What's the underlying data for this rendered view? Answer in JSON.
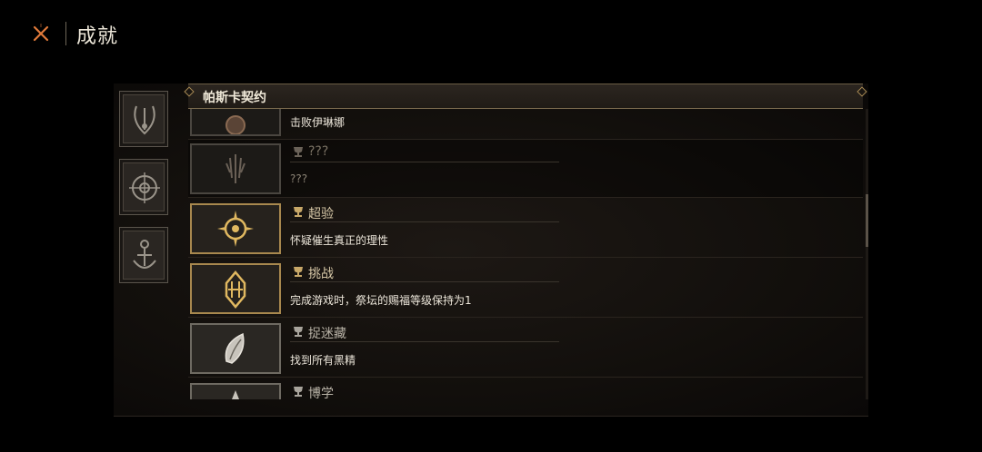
{
  "header": {
    "title": "成就"
  },
  "category": {
    "title": "帕斯卡契约"
  },
  "achievements": [
    {
      "name": "",
      "desc": "击败伊琳娜",
      "icon": "priest-head-icon"
    },
    {
      "name": "???",
      "desc": "???",
      "icon": "claw-sigil-icon"
    },
    {
      "name": "超验",
      "desc": "怀疑催生真正的理性",
      "icon": "crosshair-sun-icon"
    },
    {
      "name": "挑战",
      "desc": "完成游戏时，祭坛的赐福等级保持为1",
      "icon": "ornate-emblem-icon"
    },
    {
      "name": "捉迷藏",
      "desc": "找到所有黑精",
      "icon": "leaf-stone-icon"
    },
    {
      "name": "博学",
      "desc": "",
      "icon": "tower-icon"
    }
  ],
  "colors": {
    "accent": "#a8884e",
    "accent_glow": "#e0b860",
    "text": "#ece6da",
    "close_icon": "#e07a3a"
  }
}
